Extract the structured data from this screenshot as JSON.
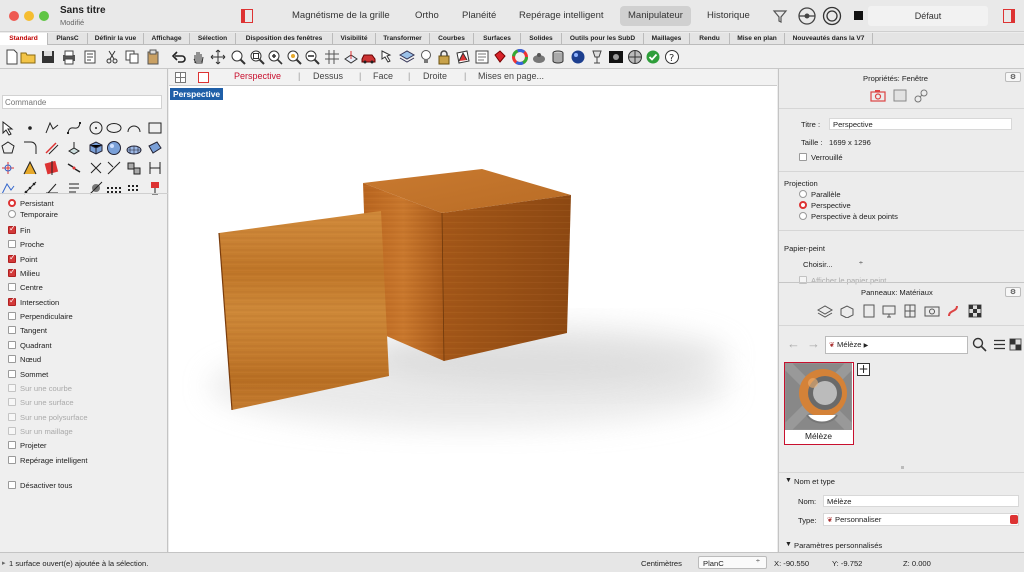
{
  "window": {
    "title": "Sans titre",
    "subtitle": "Modifié"
  },
  "toolbar_modes": [
    "Magnétisme de la grille",
    "Ortho",
    "Planéité",
    "Repérage intelligent",
    "Manipulateur",
    "Historique"
  ],
  "layer_label": "Défaut",
  "tabs": [
    "Standard",
    "PlansC",
    "Définir la vue",
    "Affichage",
    "Sélection",
    "Disposition des fenêtres",
    "Visibilité",
    "Transformer",
    "Courbes",
    "Surfaces",
    "Solides",
    "Outils pour les SubD",
    "Maillages",
    "Rendu",
    "Mise en plan",
    "Nouveautés dans la V7"
  ],
  "command_placeholder": "Commande",
  "osnap": {
    "persistent": "Persistant",
    "temporary": "Temporaire",
    "items": [
      {
        "label": "Fin",
        "checked": true,
        "disabled": false
      },
      {
        "label": "Proche",
        "checked": false,
        "disabled": false
      },
      {
        "label": "Point",
        "checked": true,
        "disabled": false
      },
      {
        "label": "Milieu",
        "checked": true,
        "disabled": false
      },
      {
        "label": "Centre",
        "checked": false,
        "disabled": false
      },
      {
        "label": "Intersection",
        "checked": true,
        "disabled": false
      },
      {
        "label": "Perpendiculaire",
        "checked": false,
        "disabled": false
      },
      {
        "label": "Tangent",
        "checked": false,
        "disabled": false
      },
      {
        "label": "Quadrant",
        "checked": false,
        "disabled": false
      },
      {
        "label": "Nœud",
        "checked": false,
        "disabled": false
      },
      {
        "label": "Sommet",
        "checked": false,
        "disabled": false
      },
      {
        "label": "Sur une courbe",
        "checked": false,
        "disabled": true
      },
      {
        "label": "Sur une surface",
        "checked": false,
        "disabled": true
      },
      {
        "label": "Sur une polysurface",
        "checked": false,
        "disabled": true
      },
      {
        "label": "Sur un maillage",
        "checked": false,
        "disabled": true
      },
      {
        "label": "Projeter",
        "checked": false,
        "disabled": false
      },
      {
        "label": "Repérage intelligent",
        "checked": false,
        "disabled": false
      }
    ],
    "disable_all": "Désactiver tous"
  },
  "viewport_tabs": [
    "Perspective",
    "Dessus",
    "Face",
    "Droite",
    "Mises en page..."
  ],
  "viewport_label": "Perspective",
  "properties": {
    "header": "Propriétés: Fenêtre",
    "title_label": "Titre :",
    "title_value": "Perspective",
    "size_label": "Taille :",
    "size_value": "1699 x 1296",
    "locked": "Verrouillé",
    "projection_header": "Projection",
    "projection_options": [
      "Parallèle",
      "Perspective",
      "Perspective à deux points"
    ],
    "projection_selected": 1,
    "wallpaper_header": "Papier-peint",
    "choose": "Choisir...",
    "show_wallpaper": "Afficher le papier peint"
  },
  "materials": {
    "header": "Panneaux: Matériaux",
    "breadcrumb": "Mélèze",
    "swatch_label": "Mélèze",
    "name_type_header": "Nom et type",
    "name_label": "Nom:",
    "name_value": "Mélèze",
    "type_label": "Type:",
    "type_value": "Personnaliser",
    "custom_params_header": "Paramètres personnalisés"
  },
  "status": {
    "message": "1 surface ouvert(e) ajoutée à la sélection.",
    "units": "Centimètres",
    "cplane": "PlanC",
    "x": "X: -90.550",
    "y": "Y: -9.752",
    "z": "Z: 0.000"
  },
  "colors": {
    "accent_red": "#c8102e",
    "selected_tab_text": "#c00000",
    "viewport_label_bg": "#1f5fa8",
    "wood": "#c97a2c"
  },
  "icons": [
    "view-filter-icon",
    "display-color-icon",
    "layer-swatch-icon",
    "viewport-grid-icon",
    "viewport-single-icon",
    "camera-icon",
    "display-icon",
    "pipe-icon",
    "gear-icon",
    "add-icon",
    "search-icon",
    "list-icon",
    "grid-view-icon",
    "back-arrow-icon",
    "forward-arrow-icon",
    "material-icon"
  ]
}
